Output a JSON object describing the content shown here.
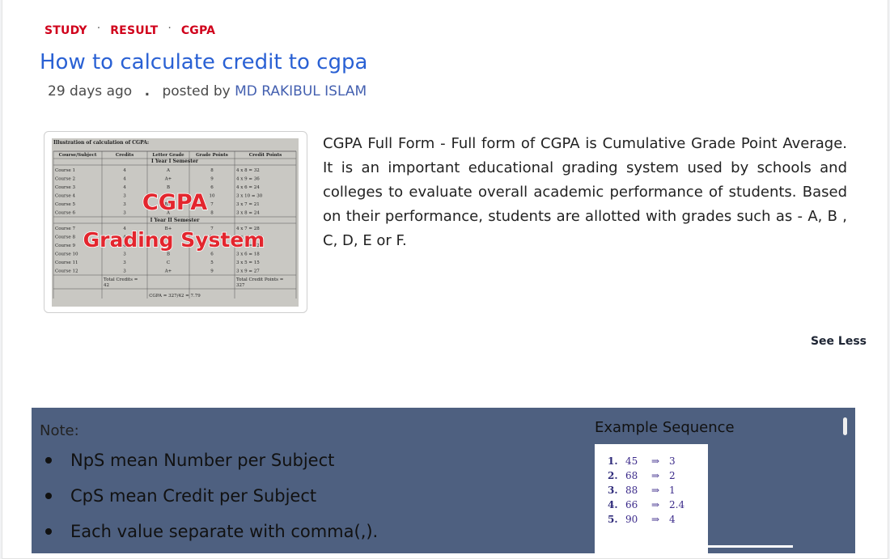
{
  "tags": [
    "STUDY",
    "RESULT",
    "CGPA"
  ],
  "separator": "·",
  "title": "How to calculate credit to cgpa",
  "meta": {
    "time": "29 days ago",
    "sep": ".",
    "posted_by": "posted by",
    "author": "MD RAKIBUL ISLAM"
  },
  "thumbnail": {
    "header": "Illustration of calculation of CGPA:",
    "columns": [
      "Course/Subject",
      "Credits",
      "Letter Grade",
      "Grade Points",
      "Credit Points"
    ],
    "sem1": "I Year I Semester",
    "sem2": "I Year II Semester",
    "rows1": [
      [
        "Course 1",
        "4",
        "A",
        "8",
        "4 x 8  = 32"
      ],
      [
        "Course 2",
        "4",
        "A+",
        "9",
        "4 x 9  = 36"
      ],
      [
        "Course 3",
        "4",
        "B",
        "6",
        "4 x 6  = 24"
      ],
      [
        "Course 4",
        "3",
        "O",
        "10",
        "3 x 10 = 30"
      ],
      [
        "Course 5",
        "3",
        "B+",
        "7",
        "3 x 7  = 21"
      ],
      [
        "Course 6",
        "3",
        "A",
        "8",
        "3 x 8  = 24"
      ]
    ],
    "rows2": [
      [
        "Course 7",
        "4",
        "B+",
        "7",
        "4 x 7  = 28"
      ],
      [
        "Course 8",
        "4",
        "O",
        "10",
        "4 x 10 = 40"
      ],
      [
        "Course 9",
        "4",
        "A",
        "8",
        "4 x 8  = 32"
      ],
      [
        "Course 10",
        "3",
        "B",
        "6",
        "3 x 6  = 18"
      ],
      [
        "Course 11",
        "3",
        "C",
        "5",
        "3 x 5  = 15"
      ],
      [
        "Course 12",
        "3",
        "A+",
        "9",
        "3 x 9  = 27"
      ]
    ],
    "total_credits": "Total Credits =",
    "total_credits_val": "42",
    "total_points": "Total Credit Points =",
    "total_points_val": "327",
    "cgpa_line": "CGPA = 327/42 = 7.79",
    "overlay1": "CGPA",
    "overlay2": "Grading System"
  },
  "description": "CGPA Full Form - Full form of CGPA is Cumulative Grade Point Average. It is an important educational grading system used by schools and colleges to evaluate overall academic performance of students. Based on their performance, students are allotted with grades such as - A, B , C, D, E or F.",
  "see_less": "See Less",
  "note": {
    "label": "Note:",
    "items": [
      "NpS mean Number per Subject",
      "CpS mean Credit per Subject",
      "Each value separate with comma(,)."
    ]
  },
  "example": {
    "title": "Example Sequence",
    "rows": [
      {
        "n": "1.",
        "a": "45",
        "arrow": "⇒",
        "b": "3"
      },
      {
        "n": "2.",
        "a": "68",
        "arrow": "⇒",
        "b": "2"
      },
      {
        "n": "3.",
        "a": "88",
        "arrow": "⇒",
        "b": "1"
      },
      {
        "n": "4.",
        "a": "66",
        "arrow": "⇒",
        "b": "2.4"
      },
      {
        "n": "5.",
        "a": "90",
        "arrow": "⇒",
        "b": "4"
      }
    ]
  },
  "colors": {
    "tag": "#d0011b",
    "title": "#2a61d4",
    "author": "#4460b0",
    "panel": "#4e6080"
  }
}
